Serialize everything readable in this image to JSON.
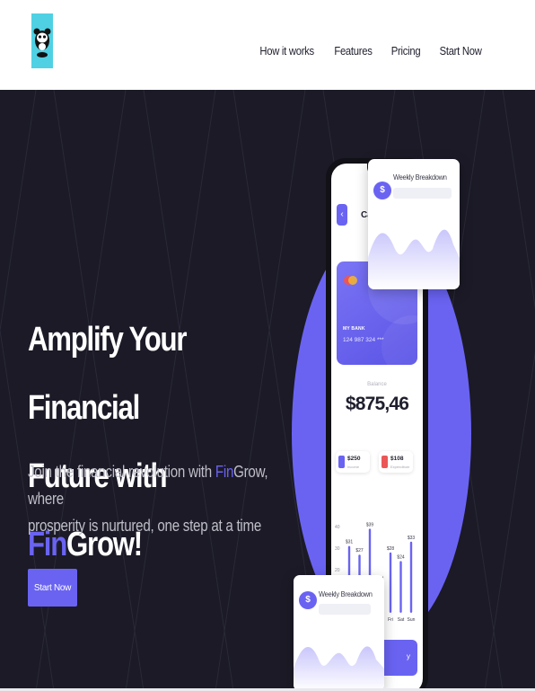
{
  "header": {
    "logo_icon": "panda-logo-icon",
    "nav": [
      "How it works",
      "Features",
      "Pricing",
      "Start Now"
    ]
  },
  "hero": {
    "headline_line1": "Amplify Your Financial",
    "headline_line2_a": "Future with ",
    "headline_brand_a": "Fin",
    "headline_brand_b": "Grow!",
    "sub_line1_a": "Join the financial revolution with ",
    "sub_brand_a": "Fin",
    "sub_brand_b": "Grow",
    "sub_line1_b": ", where",
    "sub_line2": "prosperity is nurtured, one step at a time",
    "cta_label": "Start Now"
  },
  "phone": {
    "screen_title": "Ca",
    "back_icon": "arrow-left-icon",
    "card": {
      "bank": "MY BANK",
      "number": "124 987 324 ***"
    },
    "balance_label": "Balance",
    "balance_value": "$875,46",
    "income": {
      "amount": "$250",
      "label": "Income"
    },
    "expenditure": {
      "amount": "$108",
      "label": "Expenditure"
    },
    "bottom_button_fragment": "y"
  },
  "popups": {
    "top_title": "Weekly Breakdown",
    "bottom_title": "Weekly Breakdown",
    "dollar_icon": "$"
  },
  "colors": {
    "accent": "#6a63f2",
    "hero_bg": "#1b1a26",
    "logo_bg": "#4fd1e3"
  },
  "chart_data": {
    "type": "bar",
    "y_ticks": [
      "40",
      "30",
      "20"
    ],
    "categories": [
      "",
      "",
      "",
      "",
      "Fri",
      "Sat",
      "Sun"
    ],
    "values": [
      31,
      27,
      39,
      14,
      28,
      24,
      33
    ],
    "value_labels": [
      "$31",
      "$27",
      "$39",
      "$14",
      "$28",
      "$24",
      "$33"
    ],
    "ylim": [
      0,
      45
    ]
  }
}
